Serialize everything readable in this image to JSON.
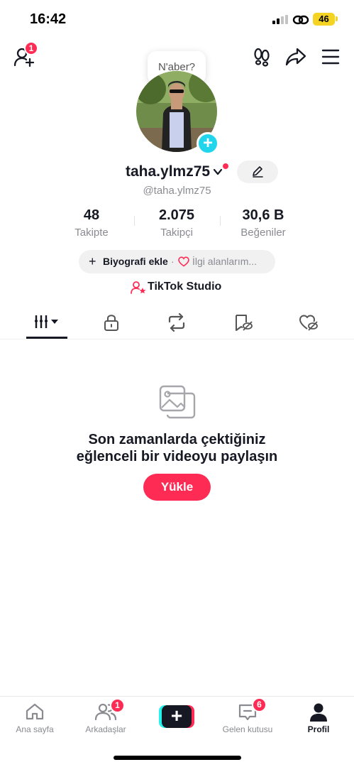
{
  "status_bar": {
    "time": "16:42",
    "battery": "46"
  },
  "header": {
    "add_friend_badge": "1",
    "icons": [
      "add-friend-icon",
      "footprints-icon",
      "share-icon",
      "menu-icon"
    ]
  },
  "profile": {
    "note_bubble": "N'aber?",
    "username": "taha.ylmz75",
    "handle": "@taha.ylmz75",
    "avatar_add_symbol": "+"
  },
  "stats": [
    {
      "value": "48",
      "label": "Takipte"
    },
    {
      "value": "2.075",
      "label": "Takipçi"
    },
    {
      "value": "30,6 B",
      "label": "Beğeniler"
    }
  ],
  "bio": {
    "plus": "+",
    "add_label": "Biyografi ekle",
    "separator": "·",
    "interests_label": "İlgi alanlarım..."
  },
  "studio": {
    "label": "TikTok Studio"
  },
  "tabs": [
    "videos-grid-icon",
    "lock-icon",
    "repost-icon",
    "hidden-bookmark-icon",
    "hidden-likes-icon"
  ],
  "empty_state": {
    "line1": "Son zamanlarda çektiğiniz",
    "line2": "eğlenceli bir videoyu paylaşın",
    "button": "Yükle"
  },
  "bottom_nav": {
    "home": "Ana sayfa",
    "friends": "Arkadaşlar",
    "friends_badge": "1",
    "create_symbol": "+",
    "inbox": "Gelen kutusu",
    "inbox_badge": "6",
    "profile": "Profil"
  },
  "colors": {
    "accent": "#fe2c55",
    "cyan": "#20d5ec",
    "text": "#161823",
    "muted": "#8a8b91"
  }
}
